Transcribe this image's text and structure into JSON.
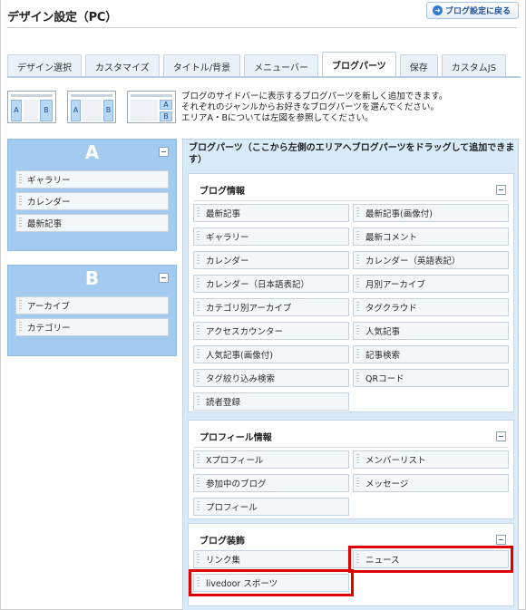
{
  "header": {
    "title": "デザイン設定（PC）",
    "back_button": "ブログ設定に戻る"
  },
  "tabs": [
    {
      "label": "デザイン選択",
      "active": false
    },
    {
      "label": "カスタマイズ",
      "active": false
    },
    {
      "label": "タイトル/背景",
      "active": false
    },
    {
      "label": "メニューバー",
      "active": false
    },
    {
      "label": "ブログパーツ",
      "active": true
    },
    {
      "label": "保存",
      "active": false
    },
    {
      "label": "カスタムJS",
      "active": false
    }
  ],
  "layout_thumbs": [
    {
      "left": "A",
      "right": "B"
    },
    {
      "left": "A",
      "right": "B"
    },
    {
      "left": "A",
      "right": "B"
    }
  ],
  "description": [
    "ブログのサイドバーに表示するブログパーツを新しく追加できます。",
    "それぞれのジャンルからお好きなブログパーツを選んでください。",
    "エリアA・Bについては左図を参照してください。"
  ],
  "area_a": {
    "label": "A",
    "items": [
      "ギャラリー",
      "カレンダー",
      "最新記事"
    ]
  },
  "area_b": {
    "label": "B",
    "items": [
      "アーカイブ",
      "カテゴリー"
    ]
  },
  "parts_panel": {
    "title": "ブログパーツ（ここから左側のエリアへブログパーツをドラッグして追加できます）",
    "groups": [
      {
        "title": "ブログ情報",
        "items": [
          "最新記事",
          "最新記事(画像付)",
          "ギャラリー",
          "最新コメント",
          "カレンダー",
          "カレンダー（英語表記）",
          "カレンダー（日本語表記）",
          "月別アーカイブ",
          "カテゴリ別アーカイブ",
          "タグクラウド",
          "アクセスカウンター",
          "人気記事",
          "人気記事(画像付)",
          "記事検索",
          "タグ絞り込み検索",
          "QRコード",
          "読者登録"
        ]
      },
      {
        "title": "プロフィール情報",
        "items": [
          "Xプロフィール",
          "メンバーリスト",
          "参加中のブログ",
          "メッセージ",
          "プロフィール"
        ]
      },
      {
        "title": "ブログ装飾",
        "items": [
          "リンク集",
          "ニュース",
          "livedoor スポーツ"
        ]
      }
    ]
  },
  "colors": {
    "area_bg": "#a3cbf0",
    "parts_bg": "#d9ebfa",
    "highlight": "#e00000",
    "link_blue": "#1c4f9c"
  }
}
